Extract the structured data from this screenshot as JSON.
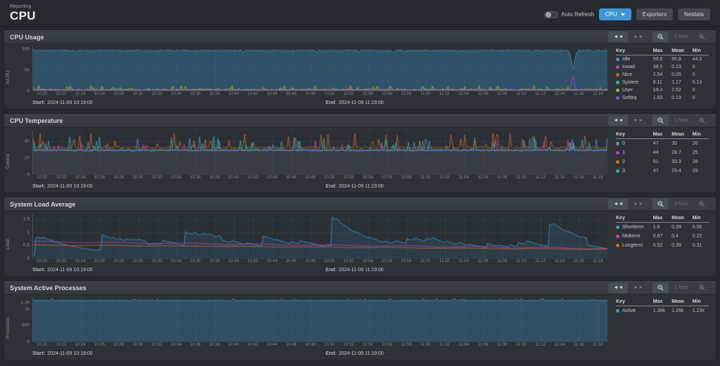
{
  "topbar": {
    "breadcrumb": "Reporting",
    "title": "CPU",
    "auto_refresh_label": "Auto Refresh",
    "scope_button_label": "CPU",
    "exporters_button_label": "Exporters",
    "netdata_button_label": "Netdata"
  },
  "icons": {
    "pan_back": "◄◄",
    "pan_forward": "►►"
  },
  "panel_controls": {
    "range_label": "1 hour"
  },
  "legend_headers": [
    "Key",
    "Max",
    "Mean",
    "Min"
  ],
  "time": {
    "start_label": "Start:",
    "start": "2024-11-09 10:19:00",
    "end_label": "End:",
    "end": "2024-11-09 11:19:00"
  },
  "x_ticks": [
    "10:20",
    "10:22",
    "10:24",
    "10:26",
    "10:28",
    "10:30",
    "10:32",
    "10:34",
    "10:36",
    "10:38",
    "10:40",
    "10:42",
    "10:44",
    "10:46",
    "10:48",
    "10:50",
    "10:52",
    "10:54",
    "10:56",
    "10:58",
    "11:00",
    "11:02",
    "11:04",
    "11:06",
    "11:08",
    "11:10",
    "11:12",
    "11:14",
    "11:16",
    "11:18"
  ],
  "colors": {
    "accent_blue": "#3d96d4",
    "series_blue": "#3e9ad2",
    "series_magenta": "#c03fc0",
    "series_orange": "#d06a28",
    "series_teal": "#2fb6a8",
    "series_olive": "#a9aa35",
    "series_purple": "#7b55cc"
  },
  "panels": [
    {
      "id": "cpu-usage",
      "title": "CPU Usage",
      "y_label": "%CPU",
      "ymax": 105,
      "legend_row_h": 11,
      "y_ticks": [
        {
          "label": "100",
          "v": 100
        },
        {
          "label": "50",
          "v": 50
        },
        {
          "label": "0",
          "v": 0
        }
      ],
      "legend": [
        {
          "name": "Idle",
          "color": "#3e9ad2",
          "max": "99.6",
          "mean": "95.8",
          "min": "44.3"
        },
        {
          "name": "Iowait",
          "color": "#c03fc0",
          "max": "38.5",
          "mean": "0.23",
          "min": "0"
        },
        {
          "name": "Nice",
          "color": "#d06a28",
          "max": "2.54",
          "mean": "0.05",
          "min": "0"
        },
        {
          "name": "System",
          "color": "#2fb6a8",
          "max": "8.11",
          "mean": "1.17",
          "min": "0.13"
        },
        {
          "name": "User",
          "color": "#a9aa35",
          "max": "19.4",
          "mean": "2.62",
          "min": "0"
        },
        {
          "name": "Softirq",
          "color": "#7b55cc",
          "max": "1.60",
          "mean": "0.13",
          "min": "0"
        }
      ],
      "series": [
        {
          "name": "Idle",
          "color": "#3e9ad2",
          "mode": "noise",
          "base": 96.5,
          "noise": 1.1,
          "spikeChance": 0.05,
          "spikeMax": 90,
          "min": 40,
          "max": 99.5,
          "fill": 0.32,
          "seed": 11,
          "events": [
            {
              "x": 0.94,
              "v": 52,
              "w": 0.004
            }
          ]
        },
        {
          "name": "User",
          "color": "#a9aa35",
          "mode": "noise",
          "base": 2.4,
          "noise": 1.8,
          "spikeChance": 0.13,
          "spikeMax": 13,
          "min": 0.3,
          "max": 19,
          "fill": 0.3,
          "seed": 12
        },
        {
          "name": "System",
          "color": "#2fb6a8",
          "mode": "noise",
          "base": 1.2,
          "noise": 0.9,
          "spikeChance": 0.06,
          "spikeMax": 6.5,
          "min": 0.15,
          "max": 8,
          "fill": 0.25,
          "seed": 13
        },
        {
          "name": "Nice",
          "color": "#d06a28",
          "mode": "noise",
          "base": 0.4,
          "noise": 0.4,
          "spikeChance": 0.03,
          "spikeMax": 2.5,
          "min": 0,
          "max": 2.5,
          "fill": 0,
          "seed": 14
        },
        {
          "name": "Softirq",
          "color": "#7b55cc",
          "mode": "noise",
          "base": 0.25,
          "noise": 0.2,
          "spikeChance": 0.01,
          "spikeMax": 1.5,
          "min": 0,
          "max": 1.6,
          "fill": 0,
          "seed": 15
        },
        {
          "name": "Iowait",
          "color": "#c03fc0",
          "mode": "noise",
          "base": 0.3,
          "noise": 0.3,
          "spikeChance": 0.02,
          "spikeMax": 2.5,
          "min": 0,
          "max": 38.5,
          "fill": 0,
          "seed": 16,
          "events": [
            {
              "x": 0.94,
              "v": 38,
              "w": 0.003
            }
          ]
        }
      ]
    },
    {
      "id": "cpu-temperature",
      "title": "CPU Temperature",
      "y_label": "Celsius",
      "ymax": 53,
      "legend_row_h": 13,
      "y_ticks": [
        {
          "label": "40",
          "v": 40
        },
        {
          "label": "20",
          "v": 20
        },
        {
          "label": "0",
          "v": 0
        }
      ],
      "legend": [
        {
          "name": "0",
          "color": "#3e9ad2",
          "max": "47",
          "mean": "30",
          "min": "26"
        },
        {
          "name": "1",
          "color": "#c03fc0",
          "max": "44",
          "mean": "28.7",
          "min": "25"
        },
        {
          "name": "2",
          "color": "#d06a28",
          "max": "51",
          "mean": "33.3",
          "min": "28"
        },
        {
          "name": "3",
          "color": "#2fb6a8",
          "max": "47",
          "mean": "29.4",
          "min": "25"
        }
      ],
      "series": [
        {
          "name": "0",
          "color": "#3e9ad2",
          "mode": "noise",
          "base": 29.5,
          "noise": 0.9,
          "spikeChance": 0.1,
          "spikeMax": 46,
          "min": 26,
          "max": 47,
          "fill": 0.05,
          "seed": 21
        },
        {
          "name": "1",
          "color": "#c03fc0",
          "mode": "noise",
          "base": 28.6,
          "noise": 0.8,
          "spikeChance": 0.08,
          "spikeMax": 43,
          "min": 25,
          "max": 44,
          "fill": 0.05,
          "seed": 22
        },
        {
          "name": "2",
          "color": "#d06a28",
          "mode": "noise",
          "base": 32.5,
          "noise": 1.1,
          "spikeChance": 0.12,
          "spikeMax": 50,
          "min": 28,
          "max": 51,
          "fill": 0.05,
          "seed": 23
        },
        {
          "name": "3",
          "color": "#2fb6a8",
          "mode": "noise",
          "base": 29.2,
          "noise": 0.9,
          "spikeChance": 0.1,
          "spikeMax": 46,
          "min": 25,
          "max": 47,
          "fill": 0.05,
          "seed": 24
        }
      ]
    },
    {
      "id": "system-load-average",
      "title": "System Load Average",
      "y_label": "Load",
      "ymax": 1.7,
      "legend_row_h": 13,
      "y_ticks": [
        {
          "label": "1.5",
          "v": 1.5
        },
        {
          "label": "1",
          "v": 1
        },
        {
          "label": "0.5",
          "v": 0.5
        },
        {
          "label": "0",
          "v": 0
        }
      ],
      "legend": [
        {
          "name": "Shortterm",
          "color": "#3e9ad2",
          "max": "1.6",
          "mean": "0.39",
          "min": "0.06"
        },
        {
          "name": "Midterm",
          "color": "#c03fc0",
          "max": "0.67",
          "mean": "0.4",
          "min": "0.22"
        },
        {
          "name": "Longterm",
          "color": "#d06a28",
          "max": "0.52",
          "mean": "0.39",
          "min": "0.31"
        }
      ],
      "series": [
        {
          "name": "Shortterm",
          "color": "#3e9ad2",
          "mode": "sawtooth",
          "floor": 0.12,
          "decay": 0.035,
          "micro": 0.1,
          "microChance": 0.2,
          "min": 0.05,
          "max": 1.6,
          "fill": 0.12,
          "seed": 31,
          "events": [
            {
              "x": 0.005,
              "v": 0.75
            },
            {
              "x": 0.06,
              "v": 0.5
            },
            {
              "x": 0.12,
              "v": 0.9
            },
            {
              "x": 0.2,
              "v": 0.55
            },
            {
              "x": 0.265,
              "v": 1.0
            },
            {
              "x": 0.33,
              "v": 0.7
            },
            {
              "x": 0.4,
              "v": 0.85
            },
            {
              "x": 0.465,
              "v": 0.6
            },
            {
              "x": 0.52,
              "v": 1.6
            },
            {
              "x": 0.585,
              "v": 0.8
            },
            {
              "x": 0.65,
              "v": 0.75
            },
            {
              "x": 0.72,
              "v": 0.65
            },
            {
              "x": 0.79,
              "v": 0.55
            },
            {
              "x": 0.845,
              "v": 0.6
            },
            {
              "x": 0.9,
              "v": 1.3
            },
            {
              "x": 0.965,
              "v": 0.5
            }
          ]
        },
        {
          "name": "Midterm",
          "color": "#c03fc0",
          "mode": "smooth",
          "start": 0.63,
          "end": 0.36,
          "wobble": 0.02,
          "noise": 0.012,
          "min": 0.2,
          "max": 0.7,
          "fill": 0,
          "seed": 32
        },
        {
          "name": "Longterm",
          "color": "#d06a28",
          "mode": "smooth",
          "start": 0.5,
          "end": 0.33,
          "wobble": 0.01,
          "noise": 0.006,
          "min": 0.3,
          "max": 0.55,
          "fill": 0,
          "seed": 33
        }
      ]
    },
    {
      "id": "system-active-processes",
      "title": "System Active Processes",
      "y_label": "Processes",
      "ymax": 1340,
      "legend_row_h": 13,
      "y_ticks": [
        {
          "label": "1.2k",
          "v": 1200
        },
        {
          "label": "1k",
          "v": 1000
        },
        {
          "label": "500",
          "v": 500
        },
        {
          "label": "0",
          "v": 0
        }
      ],
      "legend": [
        {
          "name": "Active",
          "color": "#3e9ad2",
          "max": "1.39k",
          "mean": "1.26k",
          "min": "1.23k"
        }
      ],
      "series": [
        {
          "name": "Active",
          "color": "#3e9ad2",
          "mode": "noise",
          "base": 1258,
          "noise": 7,
          "spikeChance": 0.12,
          "spikeMax": 1325,
          "min": 1235,
          "max": 1335,
          "fill": 0.3,
          "seed": 41
        }
      ]
    }
  ]
}
